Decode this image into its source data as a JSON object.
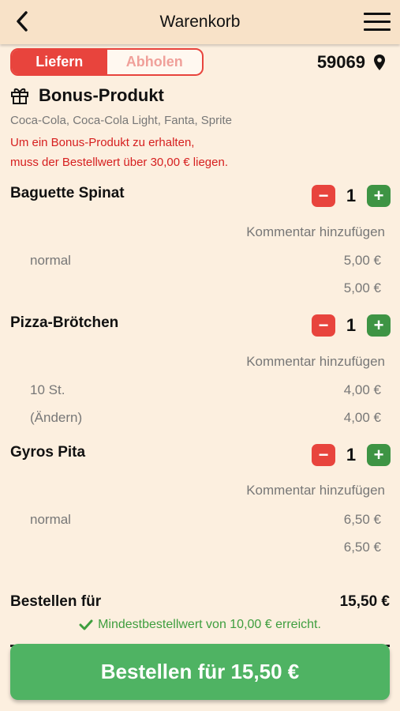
{
  "header": {
    "title": "Warenkorb"
  },
  "delivery": {
    "options": [
      "Liefern",
      "Abholen"
    ],
    "selected": "Liefern",
    "zip": "59069"
  },
  "bonus": {
    "title": "Bonus-Produkt",
    "products": "Coca-Cola, Coca-Cola Light, Fanta, Sprite",
    "note_line1": "Um ein Bonus-Produkt zu erhalten,",
    "note_line2": "muss der Bestellwert über 30,00 € liegen."
  },
  "items": [
    {
      "name": "Baguette Spinat",
      "quantity": "1",
      "comment": "Kommentar hinzufügen",
      "option_label": "normal",
      "option_price": "5,00 €",
      "extra_label": "",
      "total": "5,00 €"
    },
    {
      "name": "Pizza-Brötchen",
      "quantity": "1",
      "comment": "Kommentar hinzufügen",
      "option_label": "10 St.",
      "option_price": "4,00 €",
      "extra_label": "(Ändern)",
      "total": "4,00 €"
    },
    {
      "name": "Gyros Pita",
      "quantity": "1",
      "comment": "Kommentar hinzufügen",
      "option_label": "normal",
      "option_price": "6,50 €",
      "extra_label": "",
      "total": "6,50 €"
    }
  ],
  "summary": {
    "label": "Bestellen für",
    "total": "15,50 €",
    "minimum_note": "Mindestbestellwert von 10,00 € erreicht."
  },
  "order_button": "Bestellen für 15,50 €",
  "colors": {
    "accent_red": "#e8443d",
    "accent_green": "#4fb363",
    "background": "#fcefdf"
  }
}
